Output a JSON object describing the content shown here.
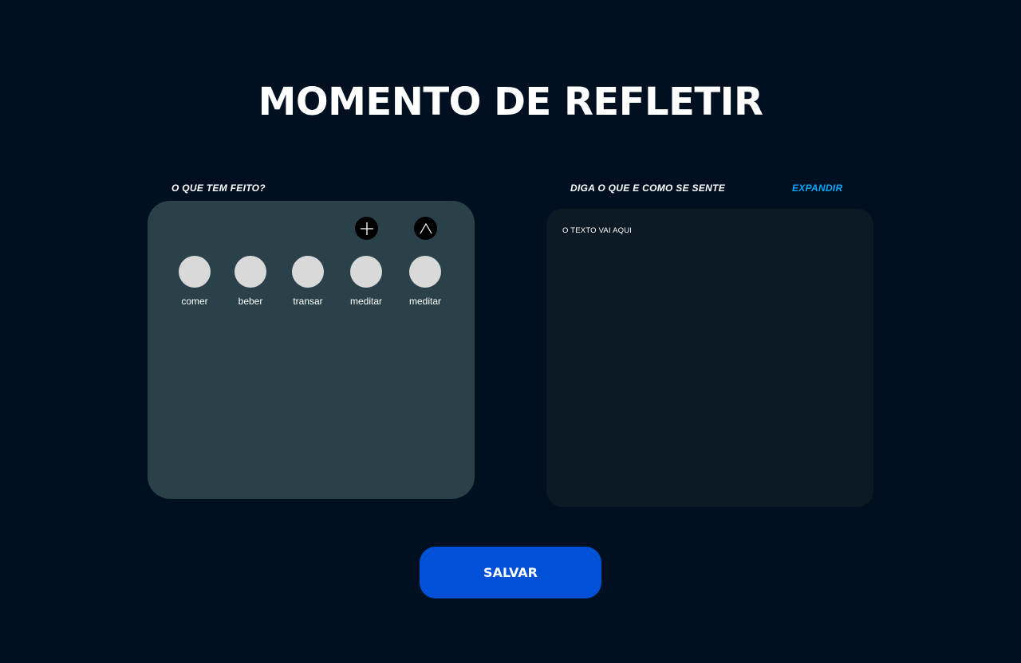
{
  "title": "MOMENTO DE REFLETIR",
  "left": {
    "label": "O QUE TEM FEITO?",
    "activities": [
      {
        "name": "comer"
      },
      {
        "name": "beber"
      },
      {
        "name": "transar"
      },
      {
        "name": "meditar"
      },
      {
        "name": "meditar"
      }
    ],
    "add_icon": "plus-icon",
    "collapse_icon": "chevron-up-icon"
  },
  "right": {
    "label": "DIGA O QUE E COMO SE SENTE",
    "expand": "EXPANDIR",
    "placeholder": "O TEXTO VAI AQUI"
  },
  "save": "SALVAR",
  "colors": {
    "background": "#001020",
    "accent": "#00a8ff",
    "button": "#0050d8"
  }
}
